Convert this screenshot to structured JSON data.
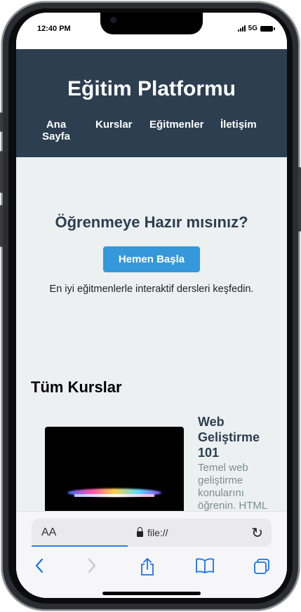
{
  "status_bar": {
    "time": "12:40 PM",
    "network": "5G"
  },
  "site": {
    "title": "Eğitim Platformu",
    "nav": [
      {
        "label": "Ana Sayfa"
      },
      {
        "label": "Kurslar"
      },
      {
        "label": "Eğitmenler"
      },
      {
        "label": "İletişim"
      }
    ]
  },
  "hero": {
    "heading": "Öğrenmeye Hazır mısınız?",
    "cta_label": "Hemen Başla",
    "subtitle": "En iyi eğitmenlerle interaktif dersleri keşfedin."
  },
  "courses": {
    "heading": "Tüm Kurslar",
    "items": [
      {
        "title": "Web Geliştirme 101",
        "description": "Temel web geliştirme konularını öğrenin. HTML"
      }
    ]
  },
  "browser": {
    "text_size_label": "AA",
    "url": "file://"
  },
  "colors": {
    "header_bg": "#2c3e50",
    "accent": "#3498db",
    "page_bg": "#ecf0f1"
  },
  "icons": [
    "reload-icon",
    "back-icon",
    "forward-icon",
    "share-icon",
    "bookmarks-icon",
    "tabs-icon",
    "lock-icon"
  ]
}
